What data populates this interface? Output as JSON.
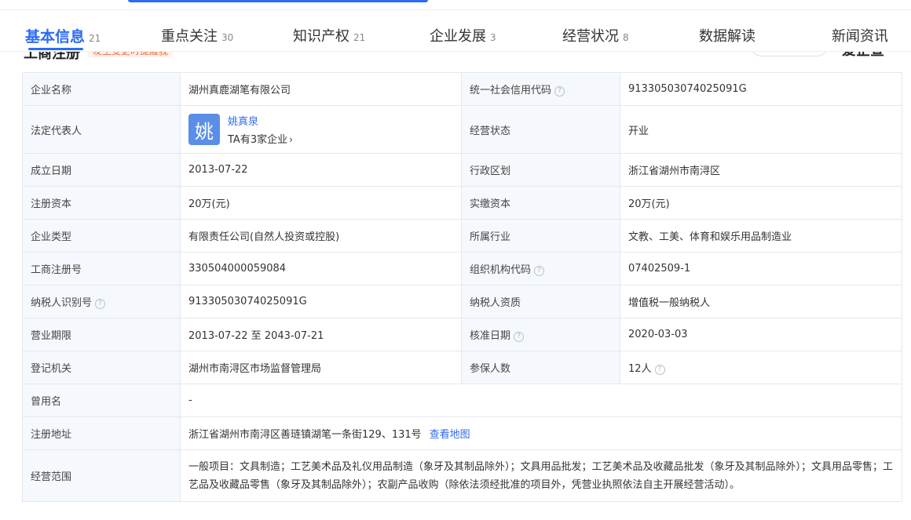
{
  "tabs": [
    {
      "label": "基本信息",
      "count": "21"
    },
    {
      "label": "重点关注",
      "count": "30"
    },
    {
      "label": "知识产权",
      "count": "21"
    },
    {
      "label": "企业发展",
      "count": "3"
    },
    {
      "label": "经营状况",
      "count": "8"
    },
    {
      "label": "数据解读",
      "count": ""
    },
    {
      "label": "新闻资讯",
      "count": ""
    }
  ],
  "section": {
    "title": "工商注册",
    "tag": "发生变更时提醒我",
    "right_logo": "爱企查"
  },
  "colors": {
    "accent": "#2d6bf4",
    "label_bg": "#f5f8fc",
    "avatar_bg": "#5b8ee6"
  },
  "rows": {
    "company_name": {
      "label": "企业名称",
      "value": "湖州真鹿湖笔有限公司"
    },
    "credit_code": {
      "label": "统一社会信用代码",
      "value": "91330503074025091G"
    },
    "legal_rep": {
      "label": "法定代表人",
      "avatar_char": "姚",
      "name": "姚真泉",
      "sub": "TA有3家企业"
    },
    "status": {
      "label": "经营状态",
      "value": "开业"
    },
    "established": {
      "label": "成立日期",
      "value": "2013-07-22"
    },
    "region": {
      "label": "行政区划",
      "value": "浙江省湖州市南浔区"
    },
    "reg_capital": {
      "label": "注册资本",
      "value": "20万(元)"
    },
    "paid_capital": {
      "label": "实缴资本",
      "value": "20万(元)"
    },
    "company_type": {
      "label": "企业类型",
      "value": "有限责任公司(自然人投资或控股)"
    },
    "industry": {
      "label": "所属行业",
      "value": "文教、工美、体育和娱乐用品制造业"
    },
    "reg_no": {
      "label": "工商注册号",
      "value": "330504000059084"
    },
    "org_code": {
      "label": "组织机构代码",
      "value": "07402509-1"
    },
    "taxpayer_id": {
      "label": "纳税人识别号",
      "value": "91330503074025091G"
    },
    "taxpayer_qual": {
      "label": "纳税人资质",
      "value": "增值税一般纳税人"
    },
    "term": {
      "label": "营业期限",
      "value": "2013-07-22 至 2043-07-21"
    },
    "approval_date": {
      "label": "核准日期",
      "value": "2020-03-03"
    },
    "authority": {
      "label": "登记机关",
      "value": "湖州市南浔区市场监督管理局"
    },
    "insured": {
      "label": "参保人数",
      "value": "12人"
    },
    "former_name": {
      "label": "曾用名",
      "value": "-"
    },
    "address": {
      "label": "注册地址",
      "value": "浙江省湖州市南浔区善琏镇湖笔一条街129、131号",
      "link": "查看地图"
    },
    "scope": {
      "label": "经营范围",
      "value": "一般项目：文具制造；工艺美术品及礼仪用品制造（象牙及其制品除外）；文具用品批发；工艺美术品及收藏品批发（象牙及其制品除外）；文具用品零售；工艺品及收藏品零售（象牙及其制品除外）；农副产品收购（除依法须经批准的项目外，凭营业执照依法自主开展经营活动）。"
    }
  },
  "help_glyph": "?",
  "chevron_glyph": "›"
}
